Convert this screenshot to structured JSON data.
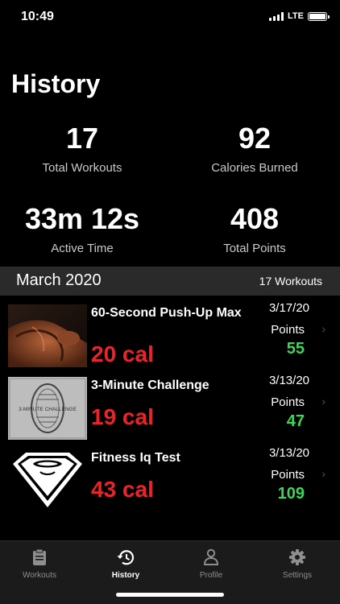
{
  "status": {
    "time": "10:49",
    "network": "LTE"
  },
  "page": {
    "title": "History"
  },
  "stats": {
    "total_workouts": {
      "value": "17",
      "label": "Total Workouts"
    },
    "calories_burned": {
      "value": "92",
      "label": "Calories Burned"
    },
    "active_time": {
      "value": "33m 12s",
      "label": "Active Time"
    },
    "total_points": {
      "value": "408",
      "label": "Total Points"
    }
  },
  "month_section": {
    "title": "March 2020",
    "count": "17 Workouts"
  },
  "workouts": [
    {
      "name": "60-Second Push-Up Max",
      "calories": "20 cal",
      "date": "3/17/20",
      "points_label": "Points",
      "points": "55",
      "thumbnail": "muscular-arm-photo"
    },
    {
      "name": "3-Minute Challenge",
      "calories": "19 cal",
      "date": "3/13/20",
      "points_label": "Points",
      "points": "47",
      "thumbnail": "3-minute-challenge-badge"
    },
    {
      "name": "Fitness Iq Test",
      "calories": "43 cal",
      "date": "3/13/20",
      "points_label": "Points",
      "points": "109",
      "thumbnail": "shield-logo"
    }
  ],
  "thumbnail_text": {
    "challenge_badge": "3-MINUTE CHALLENGE"
  },
  "tabs": [
    {
      "label": "Workouts",
      "icon": "clipboard-icon",
      "active": false
    },
    {
      "label": "History",
      "icon": "history-icon",
      "active": true
    },
    {
      "label": "Profile",
      "icon": "person-icon",
      "active": false
    },
    {
      "label": "Settings",
      "icon": "gear-icon",
      "active": false
    }
  ],
  "colors": {
    "calories": "#e8242a",
    "points": "#3fd45a",
    "background": "#000000",
    "section_header": "#2a2a2a",
    "tab_bar": "#1b1b1b"
  }
}
